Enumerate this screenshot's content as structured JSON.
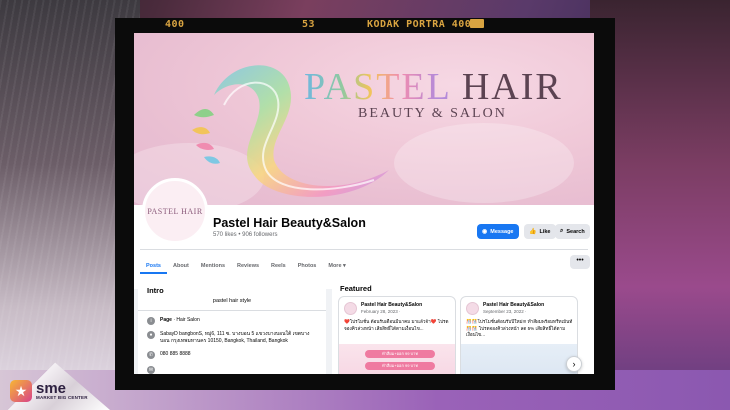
{
  "film": {
    "left_label": "400",
    "frame_number": "53",
    "stock_label": "KODAK PORTRA 400"
  },
  "cover": {
    "brand_word1": "PASTEL",
    "brand_word2": "HAIR",
    "brand_subtitle": "BEAUTY & SALON"
  },
  "page": {
    "name": "Pastel Hair Beauty&Salon",
    "stats": "570 likes • 906 followers",
    "avatar_text": "PASTEL HAIR"
  },
  "actions": {
    "message": "Message",
    "like": "Like",
    "search": "Search",
    "more": "•••"
  },
  "tabs": [
    {
      "label": "Posts"
    },
    {
      "label": "About"
    },
    {
      "label": "Mentions"
    },
    {
      "label": "Reviews"
    },
    {
      "label": "Reels"
    },
    {
      "label": "Photos"
    },
    {
      "label": "More ▾"
    }
  ],
  "intro": {
    "title": "Intro",
    "bio": "pastel hair style",
    "category_label": "Page",
    "category_value": " · Hair Salon",
    "address": "SabayD bangbonS, หมู่6, 111 ซ. บางบอน 5 แขวงบางบอนใต้ เขตบางบอน กรุงเทพมหานคร 10150, Bangkok, Thailand, Bangkok",
    "phone": "080 885 8888"
  },
  "featured": {
    "title": "Featured",
    "posts": [
      {
        "name": "Pastel Hair Beauty&Salon",
        "date": "February 28, 2023 ·",
        "text": "❤️โปรโมชั่น ต้อนรับเดือนมีนาคม มาแล้วจ้า❤️ โปรดจองคิวล่วงหน้า เสียสิทธิ์ได้ตามเงื่อนไข...",
        "pill1": "ทำสีผม+ออก 99 บาท",
        "pill2": "ทำสีผม+ออก 99 บาท"
      },
      {
        "name": "Pastel Hair Beauty&Salon",
        "date": "September 23, 2022 ·",
        "text": "🎊🎊โปรโมชั่นต้อนรับปีใหม่!!! ทำสีผมพร้อมทรีทเม้นท์🎊🎊 โปรดจองคิวล่วงหน้า ลด 5% เสียสิทธิ์ได้ตามเงื่อนไข..."
      }
    ]
  },
  "footer_logo": {
    "name": "sme",
    "subtitle": "MARKET BIG CENTER"
  },
  "colors": {
    "facebook_blue": "#1877f2",
    "film_orange": "#d9a441",
    "pill_pink": "#ef7aa0"
  }
}
